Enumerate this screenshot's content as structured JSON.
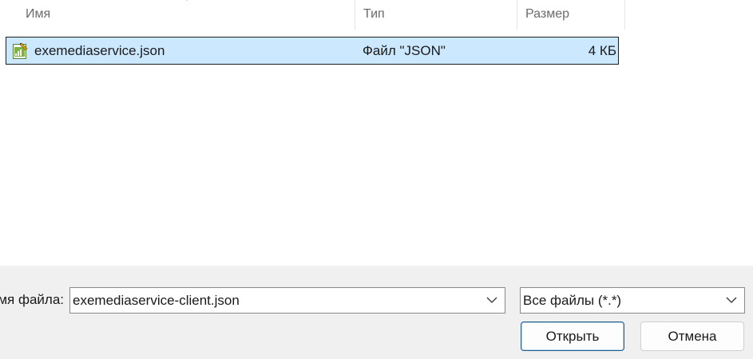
{
  "columns": {
    "name": "Имя",
    "type": "Тип",
    "size": "Размер"
  },
  "files": [
    {
      "icon": "json-file-icon",
      "name": "exemediaservice.json",
      "type": "Файл \"JSON\"",
      "size": "4 КБ",
      "selected": true
    }
  ],
  "bottom": {
    "filename_label": "Имя файла:",
    "filename_value": "exemediaservice-client.json",
    "filter_value": "Все файлы (*.*)",
    "open_label": "Открыть",
    "cancel_label": "Отмена"
  },
  "colors": {
    "selection": "#cce8ff",
    "bottom_bar": "#f0f0f0",
    "header_text": "#6b6b6b"
  }
}
